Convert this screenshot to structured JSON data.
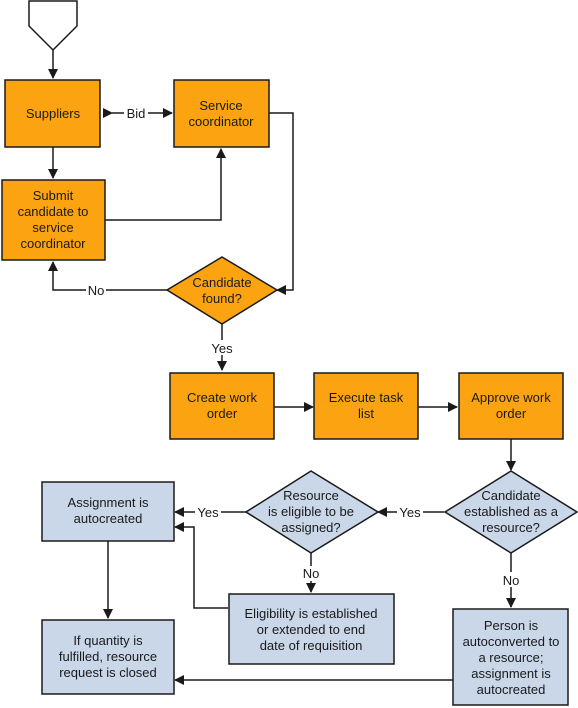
{
  "diagram": {
    "colors": {
      "process_primary": "#fca311",
      "process_secondary": "#c9d7e9",
      "stroke": "#1a1a1a"
    },
    "nodes": {
      "start": {
        "shape": "off-page-connector",
        "lines": []
      },
      "suppliers": {
        "shape": "process",
        "lines": [
          "Suppliers"
        ]
      },
      "service_coordinator": {
        "shape": "process",
        "lines": [
          "Service",
          "coordinator"
        ]
      },
      "submit_candidate": {
        "shape": "process",
        "lines": [
          "Submit",
          "candidate to",
          "service",
          "coordinator"
        ]
      },
      "candidate_found": {
        "shape": "decision",
        "lines": [
          "Candidate",
          "found?"
        ]
      },
      "create_work_order": {
        "shape": "process",
        "lines": [
          "Create work",
          "order"
        ]
      },
      "execute_task_list": {
        "shape": "process",
        "lines": [
          "Execute task",
          "list"
        ]
      },
      "approve_work_order": {
        "shape": "process",
        "lines": [
          "Approve work",
          "order"
        ]
      },
      "candidate_established": {
        "shape": "decision",
        "lines": [
          "Candidate",
          "established as a",
          "resource?"
        ]
      },
      "resource_eligible": {
        "shape": "decision",
        "lines": [
          "Resource",
          "is eligible to be",
          "assigned?"
        ]
      },
      "assignment_autocreated": {
        "shape": "process",
        "lines": [
          "Assignment is",
          "autocreated"
        ]
      },
      "eligibility_established": {
        "shape": "process",
        "lines": [
          "Eligibility is established",
          "or extended to end",
          "date of requisition"
        ]
      },
      "person_autoconverted": {
        "shape": "process",
        "lines": [
          "Person is",
          "autoconverted to",
          "a resource;",
          "assignment is",
          "autocreated"
        ]
      },
      "quantity_fulfilled": {
        "shape": "process",
        "lines": [
          "If quantity is",
          "fulfilled, resource",
          "request is closed"
        ]
      }
    },
    "edge_labels": {
      "bid": "Bid",
      "candidate_found_no": "No",
      "candidate_found_yes": "Yes",
      "established_yes": "Yes",
      "established_no": "No",
      "eligible_yes": "Yes",
      "eligible_no": "No"
    }
  }
}
